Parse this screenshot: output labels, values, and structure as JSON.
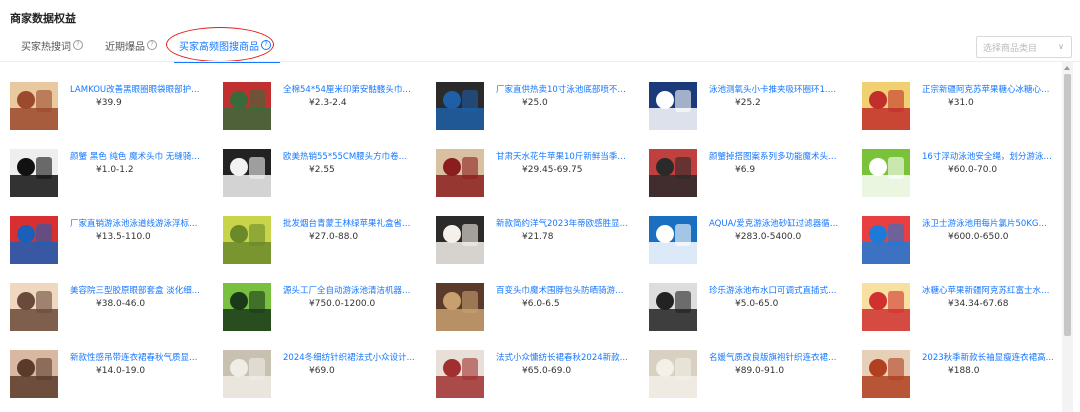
{
  "page_title": "商家数据权益",
  "tabs": [
    {
      "label": "买家热搜词",
      "help": "?"
    },
    {
      "label": "近期爆品",
      "help": "?"
    },
    {
      "label": "买家高频图搜商品",
      "help": "?"
    }
  ],
  "category_select": {
    "placeholder": "选择商品类目",
    "chevron": "∨"
  },
  "products": [
    {
      "name": "LAMKOU改善黑眼圈眼袋眼部护理...",
      "price": "¥39.9",
      "colors": [
        "#9b4a2c",
        "#e9c9a0"
      ]
    },
    {
      "name": "全棉54*54厘米印第安骷髅头巾方...",
      "price": "¥2.3-2.4",
      "colors": [
        "#3a6a3a",
        "#c03030"
      ]
    },
    {
      "name": "厂家直供热卖10寸泳池底部喷不锈...",
      "price": "¥25.0",
      "colors": [
        "#1e5fa8",
        "#2a2a2a"
      ]
    },
    {
      "name": "泳池测氧头小卡推夹吸环圈环1.5...",
      "price": "¥25.2",
      "colors": [
        "#ffffff",
        "#1a3a7a"
      ]
    },
    {
      "name": "正宗新疆阿克苏苹果糖心冰糖心丑...",
      "price": "¥31.0",
      "colors": [
        "#c22e2a",
        "#f0d070"
      ]
    },
    {
      "name": "颜蟹 黑色 纯色 魔术头巾 无缝骑行...",
      "price": "¥1.0-1.2",
      "colors": [
        "#111111",
        "#eeeeee"
      ]
    },
    {
      "name": "欧美热销55*55CM腰头方巾卷边户...",
      "price": "¥2.55",
      "colors": [
        "#f2f2f2",
        "#222222"
      ]
    },
    {
      "name": "甘肃天水花牛苹果10斤新鲜当季水...",
      "price": "¥29.45-69.75",
      "colors": [
        "#8a1e1e",
        "#d9c0a0"
      ]
    },
    {
      "name": "颜蟹掉搭图案系列多功能魔术头巾...",
      "price": "¥6.9",
      "colors": [
        "#2a2a2a",
        "#c04040"
      ]
    },
    {
      "name": "16寸浮动泳池安全绳，划分游泳赛...",
      "price": "¥60.0-70.0",
      "colors": [
        "#ffffff",
        "#7ac23a"
      ]
    },
    {
      "name": "厂家直销游泳池泳道线游泳浮标准...",
      "price": "¥13.5-110.0",
      "colors": [
        "#1d5fb8",
        "#d83030"
      ]
    },
    {
      "name": "批发烟台青蒙王林绿苹果礼盒省脆...",
      "price": "¥27.0-88.0",
      "colors": [
        "#6a8a2a",
        "#c8d44a"
      ]
    },
    {
      "name": "新款简约洋气2023年蒂欧感胜显...",
      "price": "¥21.78",
      "colors": [
        "#f5f0ea",
        "#2a2a2a"
      ]
    },
    {
      "name": "AQUA/爱克游泳池砂缸过滤器循环...",
      "price": "¥283.0-5400.0",
      "colors": [
        "#ffffff",
        "#1a6fc0"
      ]
    },
    {
      "name": "泳卫士游泳池用每片氯片50KG速...",
      "price": "¥600.0-650.0",
      "colors": [
        "#1e7ad8",
        "#e84040"
      ]
    },
    {
      "name": "美容院三型胶原眼部套盒 淡化细...",
      "price": "¥38.0-46.0",
      "colors": [
        "#6a4a3a",
        "#f0d8c0"
      ]
    },
    {
      "name": "源头工厂全自动游泳池清洁机器人...",
      "price": "¥750.0-1200.0",
      "colors": [
        "#1a3a1a",
        "#7ac040"
      ]
    },
    {
      "name": "百变头巾魔术围脖包头防晒骑游钩...",
      "price": "¥6.0-6.5",
      "colors": [
        "#c8a070",
        "#5a3a2a"
      ]
    },
    {
      "name": "珍乐游泳池布水口可调式直插式池...",
      "price": "¥5.0-65.0",
      "colors": [
        "#222222",
        "#dddddd"
      ]
    },
    {
      "name": "冰糖心苹果新疆阿克苏红富士水果...",
      "price": "¥34.34-67.68",
      "colors": [
        "#d03030",
        "#f8e0a0"
      ]
    },
    {
      "name": "新款性感吊带连衣裙春秋气质显瘦...",
      "price": "¥14.0-19.0",
      "colors": [
        "#5a3a2a",
        "#d8b8a0"
      ]
    },
    {
      "name": "2024冬细纺针织裙法式小众设计...",
      "price": "¥69.0",
      "colors": [
        "#f0ece6",
        "#c8c0b0"
      ]
    },
    {
      "name": "法式小众慵纺长裙春秋2024新款...",
      "price": "¥65.0-69.0",
      "colors": [
        "#a03030",
        "#e8e0d8"
      ]
    },
    {
      "name": "名媛气质改良版旗袍针织连衣裙女...",
      "price": "¥89.0-91.0",
      "colors": [
        "#f4f0e8",
        "#d8d0c0"
      ]
    },
    {
      "name": "2023秋季新款长袖显瘦连衣裙高...",
      "price": "¥188.0",
      "colors": [
        "#b04020",
        "#e8d0b8"
      ]
    }
  ]
}
